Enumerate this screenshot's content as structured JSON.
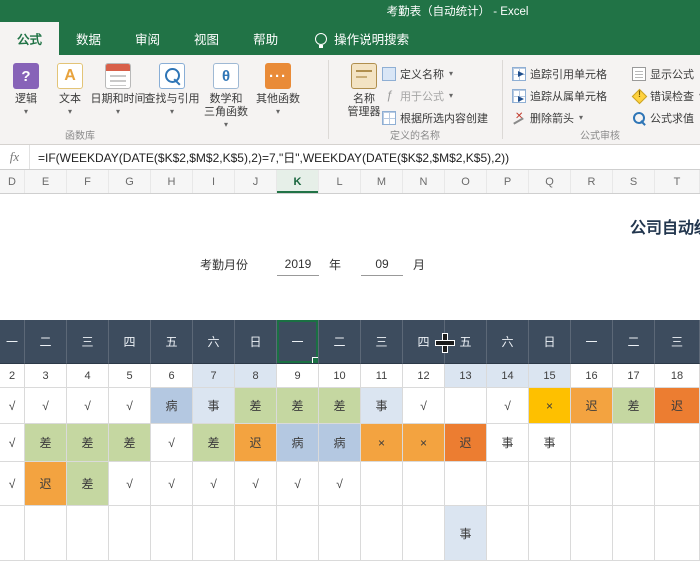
{
  "title_bar": {
    "title": "考勤表（自动统计） - Excel"
  },
  "ribbon_tabs": {
    "formulas": "公式",
    "data": "数据",
    "review": "审阅",
    "view": "视图",
    "help": "帮助",
    "search_label": "操作说明搜索"
  },
  "ribbon": {
    "function_library": {
      "group_label": "函数库",
      "logic": "逻辑",
      "text": "文本",
      "datetime": "日期和时间",
      "lookup": "查找与引用",
      "math_line1": "数学和",
      "math_line2": "三角函数",
      "more_functions": "其他函数"
    },
    "defined_names": {
      "group_label": "定义的名称",
      "name_manager_line1": "名称",
      "name_manager_line2": "管理器",
      "define_name": "定义名称",
      "use_in_formula": "用于公式",
      "create_from_selection": "根据所选内容创建"
    },
    "formula_auditing": {
      "group_label": "公式审核",
      "trace_precedents": "追踪引用单元格",
      "trace_dependents": "追踪从属单元格",
      "remove_arrows": "删除箭头",
      "show_formulas": "显示公式",
      "error_checking": "错误检查",
      "evaluate_formula": "公式求值"
    }
  },
  "formula_bar": {
    "fx_label": "fx",
    "formula": "=IF(WEEKDAY(DATE($K$2,$M$2,K$5),2)=7,\"日\",WEEKDAY(DATE($K$2,$M$2,K$5),2))"
  },
  "sheet": {
    "title": "公司自动统计",
    "month_label": "考勤月份",
    "year_value": "2019",
    "year_unit": "年",
    "month_value": "09",
    "month_unit": "月"
  },
  "grid": {
    "column_letters": [
      "D",
      "E",
      "F",
      "G",
      "H",
      "I",
      "J",
      "K",
      "L",
      "M",
      "N",
      "O",
      "P",
      "Q",
      "R",
      "S",
      "T"
    ],
    "selected_column": "K",
    "selected_cell": "K4",
    "weekdays": [
      "一",
      "二",
      "三",
      "四",
      "五",
      "六",
      "日",
      "一",
      "二",
      "三",
      "四",
      "五",
      "六",
      "日",
      "一",
      "二",
      "三"
    ],
    "days": [
      "2",
      "3",
      "4",
      "5",
      "6",
      "7",
      "8",
      "9",
      "10",
      "11",
      "12",
      "13",
      "14",
      "15",
      "16",
      "17",
      "18"
    ],
    "shaded_day_indexes": [
      5,
      6,
      11,
      12,
      13
    ],
    "rows": [
      [
        {
          "t": "√"
        },
        {
          "t": "√"
        },
        {
          "t": "√"
        },
        {
          "t": "√"
        },
        {
          "t": "病",
          "f": "blue"
        },
        {
          "t": "事",
          "f": "lightblue"
        },
        {
          "t": "差",
          "f": "green"
        },
        {
          "t": "差",
          "f": "green"
        },
        {
          "t": "差",
          "f": "green"
        },
        {
          "t": "事",
          "f": "lightblue"
        },
        {
          "t": "√"
        },
        {
          "t": ""
        },
        {
          "t": "√"
        },
        {
          "t": "×",
          "f": "yellow"
        },
        {
          "t": "迟",
          "f": "orange"
        },
        {
          "t": "差",
          "f": "green"
        },
        {
          "t": "迟",
          "f": "deeporange"
        }
      ],
      [
        {
          "t": "√"
        },
        {
          "t": "差",
          "f": "green"
        },
        {
          "t": "差",
          "f": "green"
        },
        {
          "t": "差",
          "f": "green"
        },
        {
          "t": "√"
        },
        {
          "t": "差",
          "f": "green"
        },
        {
          "t": "迟",
          "f": "orange"
        },
        {
          "t": "病",
          "f": "blue"
        },
        {
          "t": "病",
          "f": "blue"
        },
        {
          "t": "×",
          "f": "orange"
        },
        {
          "t": "×",
          "f": "orange"
        },
        {
          "t": "迟",
          "f": "deeporange"
        },
        {
          "t": "事"
        },
        {
          "t": "事"
        },
        {
          "t": ""
        },
        {
          "t": ""
        },
        {
          "t": ""
        }
      ],
      [
        {
          "t": "√"
        },
        {
          "t": "迟",
          "f": "orange"
        },
        {
          "t": "差",
          "f": "green"
        },
        {
          "t": "√"
        },
        {
          "t": "√"
        },
        {
          "t": "√"
        },
        {
          "t": "√"
        },
        {
          "t": "√"
        },
        {
          "t": "√"
        },
        {
          "t": ""
        },
        {
          "t": ""
        },
        {
          "t": ""
        },
        {
          "t": ""
        },
        {
          "t": ""
        },
        {
          "t": ""
        },
        {
          "t": ""
        },
        {
          "t": ""
        }
      ],
      [
        {
          "t": ""
        },
        {
          "t": ""
        },
        {
          "t": ""
        },
        {
          "t": ""
        },
        {
          "t": ""
        },
        {
          "t": ""
        },
        {
          "t": ""
        },
        {
          "t": ""
        },
        {
          "t": ""
        },
        {
          "t": ""
        },
        {
          "t": ""
        },
        {
          "t": "事",
          "f": "lightblue"
        },
        {
          "t": ""
        },
        {
          "t": ""
        },
        {
          "t": ""
        },
        {
          "t": ""
        },
        {
          "t": ""
        }
      ]
    ],
    "colors": {
      "green": "#c5d7a1",
      "blue": "#b4c8e1",
      "lightblue": "#dbe5f1",
      "orange": "#f3a340",
      "deeporange": "#ec7d31",
      "yellow": "#fec000",
      "header_dark": "#3d4c5e",
      "excel_green": "#217346"
    }
  }
}
